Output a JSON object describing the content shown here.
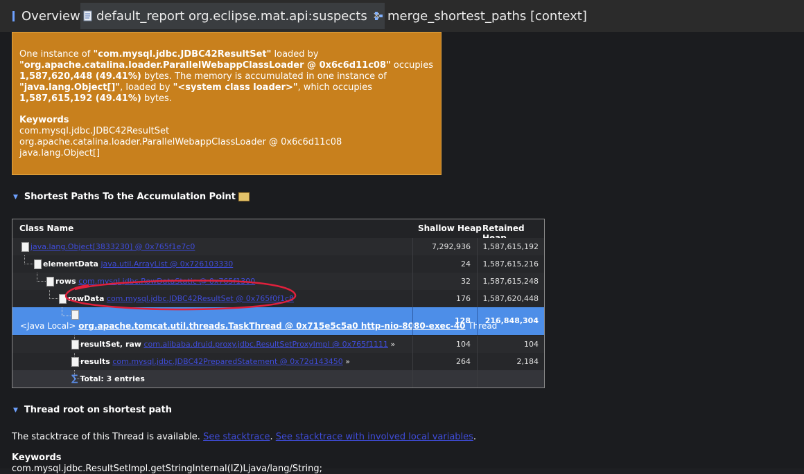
{
  "tabs": [
    {
      "label": "Overview"
    },
    {
      "label": "default_report  org.eclipse.mat.api:suspects"
    },
    {
      "label": "merge_shortest_paths  [context]"
    }
  ],
  "close_glyph": "✕",
  "suspect": {
    "p1": "One instance of ",
    "cls": "\"com.mysql.jdbc.JDBC42ResultSet\"",
    "p2": " loaded by",
    "loader": "\"org.apache.catalina.loader.ParallelWebappClassLoader @ 0x6c6d11c08\"",
    "p3": " occupies",
    "bytes1": "1,587,620,448 (49.41%)",
    "p4": " bytes. The memory is accumulated in one instance of",
    "arr": "\"java.lang.Object[]\"",
    "p5": ", loaded by ",
    "sysloader": "\"<system class loader>\"",
    "p6": ", which occupies",
    "bytes2": "1,587,615,192 (49.41%)",
    "p7": " bytes.",
    "keywords_title": "Keywords",
    "keywords": [
      "com.mysql.jdbc.JDBC42ResultSet",
      "org.apache.catalina.loader.ParallelWebappClassLoader @ 0x6c6d11c08",
      "java.lang.Object[]"
    ]
  },
  "shortest_paths": {
    "title": "Shortest Paths To the Accumulation Point",
    "columns": [
      "Class Name",
      "Shallow Heap",
      "Retained Heap"
    ],
    "rows": [
      {
        "name": "",
        "link": "java.lang.Object[3833230] @ 0x765f1e7c0",
        "shallow": "7,292,936",
        "retained": "1,587,615,192"
      },
      {
        "name": "elementData",
        "link": "java.util.ArrayList @ 0x726103330",
        "shallow": "24",
        "retained": "1,587,615,216"
      },
      {
        "name": "rows",
        "link": "com.mysql.jdbc.RowDataStatic @ 0x765f1300",
        "shallow": "32",
        "retained": "1,587,615,248"
      },
      {
        "name": "rowData",
        "link": "com.mysql.jdbc.JDBC42ResultSet @ 0x765f0f1c8",
        "shallow": "176",
        "retained": "1,587,620,448"
      },
      {
        "prefix": "<Java Local>",
        "link": "org.apache.tomcat.util.threads.TaskThread @ 0x715e5c5a0 http-nio-8080-exec-40",
        "suffix": "Thread",
        "shallow": "128",
        "retained": "216,848,304"
      },
      {
        "name": "resultSet, raw",
        "link": "com.alibaba.druid.proxy.jdbc.ResultSetProxyImpl @ 0x765f1111",
        "more": "»",
        "shallow": "104",
        "retained": "104"
      },
      {
        "name": "results",
        "link": "com.mysql.jdbc.JDBC42PreparedStatement @ 0x72d143450",
        "more": "»",
        "shallow": "264",
        "retained": "2,184"
      }
    ],
    "total": "Total: 3 entries"
  },
  "thread_root": {
    "title": "Thread root on shortest path",
    "text": "The stacktrace of this Thread is available. ",
    "link1": "See stacktrace",
    "sep": ". ",
    "link2": "See stacktrace with involved local variables",
    "end": ".",
    "keywords_title": "Keywords",
    "keywords_value": "com.mysql.jdbc.ResultSetImpl.getStringInternal(IZ)Ljava/lang/String;"
  },
  "annotation_color": "#e0203c"
}
